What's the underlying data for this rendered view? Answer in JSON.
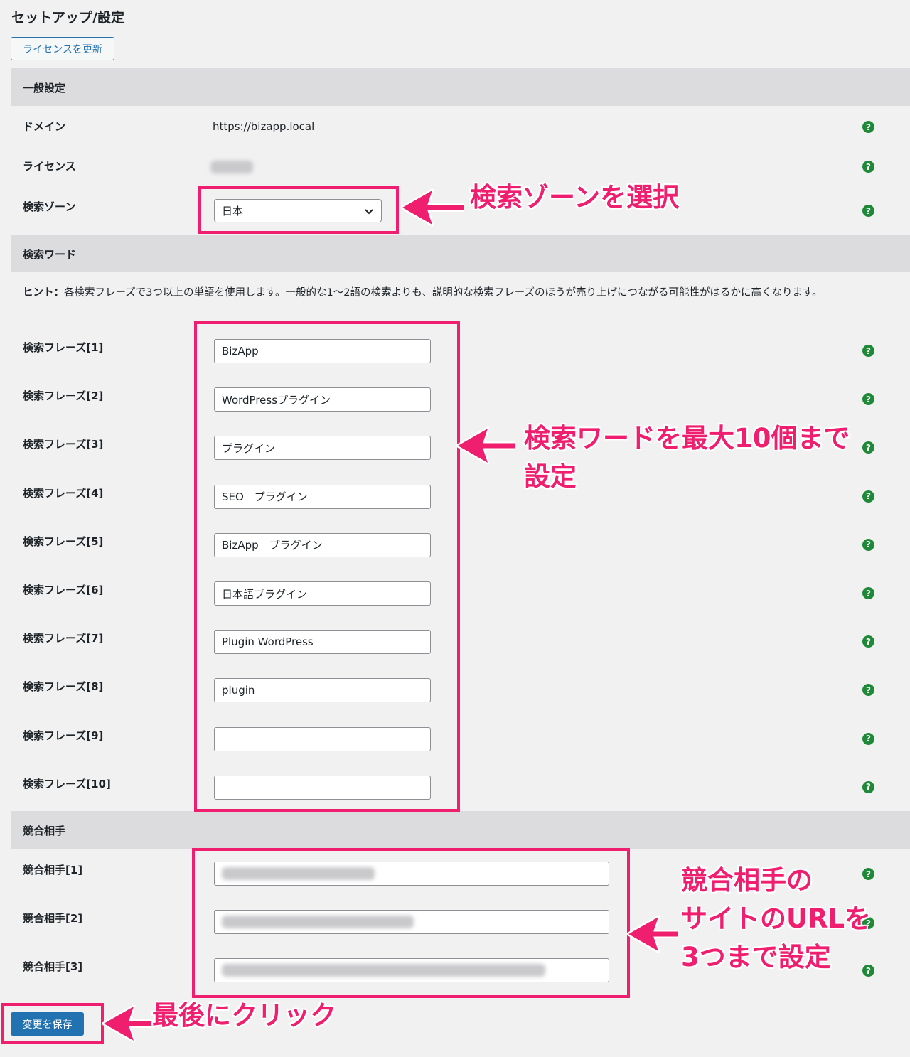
{
  "page_title": "セットアップ/設定",
  "license_button": "ライセンスを更新",
  "general": {
    "heading": "一般設定",
    "domain_label": "ドメイン",
    "domain_value": "https://bizapp.local",
    "license_label": "ライセンス",
    "zone_label": "検索ゾーン",
    "zone_value": "日本"
  },
  "keywords": {
    "heading": "検索ワード",
    "hint_prefix": "ヒント：",
    "hint_text": "各検索フレーズで3つ以上の単語を使用します。一般的な1〜2語の検索よりも、説明的な検索フレーズのほうが売り上げにつながる可能性がはるかに高くなります。",
    "phrases": [
      {
        "label": "検索フレーズ[1]",
        "value": "BizApp"
      },
      {
        "label": "検索フレーズ[2]",
        "value": "WordPressプラグイン"
      },
      {
        "label": "検索フレーズ[3]",
        "value": "プラグイン"
      },
      {
        "label": "検索フレーズ[4]",
        "value": "SEO　プラグイン"
      },
      {
        "label": "検索フレーズ[5]",
        "value": "BizApp　プラグイン"
      },
      {
        "label": "検索フレーズ[6]",
        "value": "日本語プラグイン"
      },
      {
        "label": "検索フレーズ[7]",
        "value": "Plugin WordPress"
      },
      {
        "label": "検索フレーズ[8]",
        "value": "plugin"
      },
      {
        "label": "検索フレーズ[9]",
        "value": ""
      },
      {
        "label": "検索フレーズ[10]",
        "value": ""
      }
    ]
  },
  "competitors": {
    "heading": "競合相手",
    "items": [
      {
        "label": "競合相手[1]"
      },
      {
        "label": "競合相手[2]"
      },
      {
        "label": "競合相手[3]"
      }
    ]
  },
  "save_button": "変更を保存",
  "help_glyph": "?",
  "annotations": {
    "zone": "検索ゾーンを選択",
    "keywords_line1": "検索ワードを最大10個まで",
    "keywords_line2": "設定",
    "competitors_line1": "競合相手の",
    "competitors_line2": "サイトのURLを",
    "competitors_line3": "3つまで設定",
    "save": "最後にクリック"
  },
  "colors": {
    "accent": "#2271b1",
    "annotation": "#f01e6e",
    "help_icon": "#1e8a38",
    "section_band": "#dcdcde"
  }
}
